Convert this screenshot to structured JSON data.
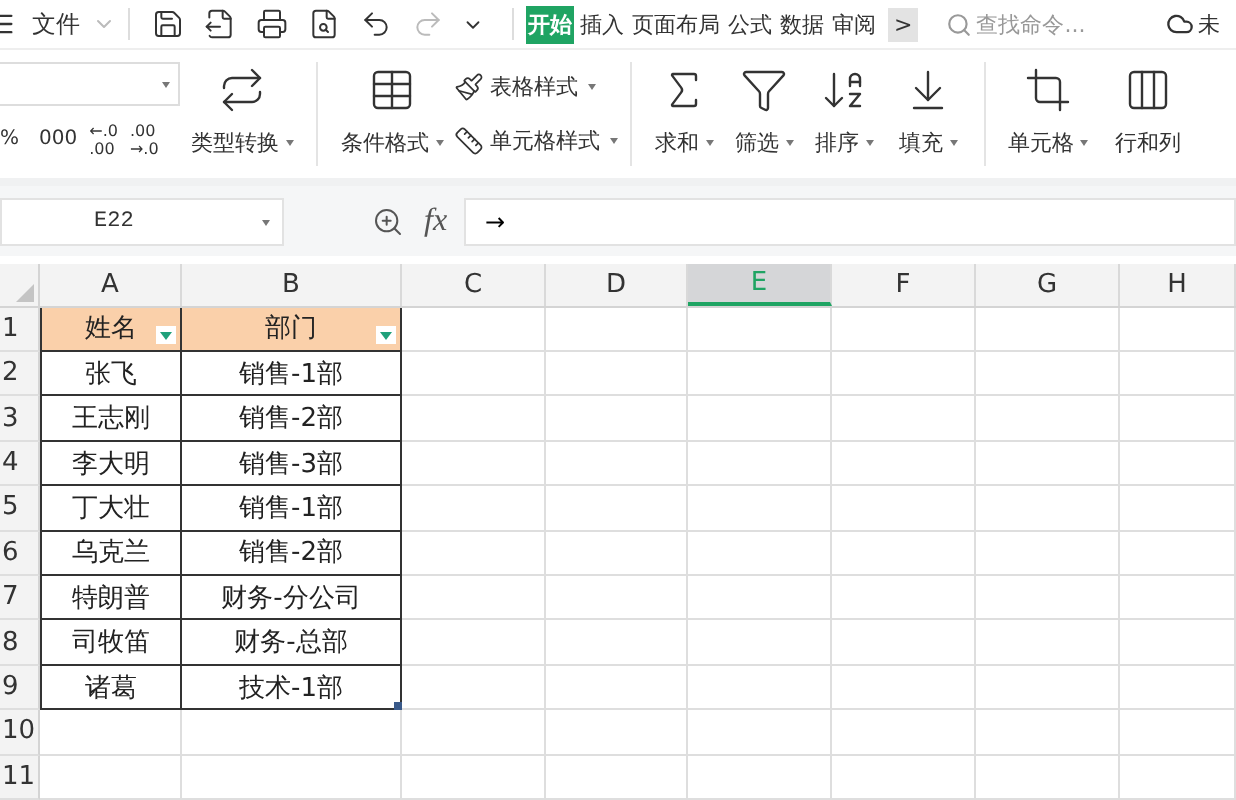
{
  "menu_bar": {
    "file_menu": "文件",
    "tabs": [
      {
        "label": "开始",
        "selected": true
      },
      {
        "label": "插入",
        "selected": false
      },
      {
        "label": "页面布局",
        "selected": false
      },
      {
        "label": "公式",
        "selected": false
      },
      {
        "label": "数据",
        "selected": false
      },
      {
        "label": "审阅",
        "selected": false
      }
    ],
    "more_tabs": ">",
    "search": {
      "placeholder": "查找命令..."
    },
    "cloud_status": "未"
  },
  "ribbon": {
    "percent": "%",
    "thousands": "000",
    "decimal_buttons": [
      {
        "top": "←.0",
        "bottom": ".00"
      },
      {
        "top": ".00",
        "bottom": "→.0"
      }
    ],
    "large_buttons_left": [
      {
        "label": "类型转换",
        "has_menu": true
      },
      {
        "label": "条件格式",
        "has_menu": true
      }
    ],
    "small_buttons": [
      {
        "label": "表格样式",
        "has_menu": true
      },
      {
        "label": "单元格样式",
        "has_menu": true
      }
    ],
    "large_buttons_right": [
      {
        "label": "求和",
        "has_menu": true
      },
      {
        "label": "筛选",
        "has_menu": true
      },
      {
        "label": "排序",
        "has_menu": true
      },
      {
        "label": "填充",
        "has_menu": true
      },
      {
        "label": "单元格",
        "has_menu": true
      },
      {
        "label": "行和列",
        "has_menu": false
      }
    ]
  },
  "formula_bar": {
    "name_box": "E22",
    "function_label": "fx",
    "value": "→"
  },
  "sheet": {
    "columns": [
      {
        "label": "A",
        "selected": false
      },
      {
        "label": "B",
        "selected": false
      },
      {
        "label": "C",
        "selected": false
      },
      {
        "label": "D",
        "selected": false
      },
      {
        "label": "E",
        "selected": true
      },
      {
        "label": "F",
        "selected": false
      },
      {
        "label": "G",
        "selected": false
      },
      {
        "label": "H",
        "selected": false
      }
    ],
    "rows": [
      {
        "number": "1",
        "kind": "header",
        "cells": [
          "姓名",
          "部门"
        ]
      },
      {
        "number": "2",
        "kind": "data",
        "cells": [
          "张飞",
          "销售-1部"
        ]
      },
      {
        "number": "3",
        "kind": "data",
        "cells": [
          "王志刚",
          "销售-2部"
        ]
      },
      {
        "number": "4",
        "kind": "data",
        "cells": [
          "李大明",
          "销售-3部"
        ]
      },
      {
        "number": "5",
        "kind": "data",
        "cells": [
          "丁大壮",
          "销售-1部"
        ]
      },
      {
        "number": "6",
        "kind": "data",
        "cells": [
          "乌克兰",
          "销售-2部"
        ]
      },
      {
        "number": "7",
        "kind": "data",
        "cells": [
          "特朗普",
          "财务-分公司"
        ]
      },
      {
        "number": "8",
        "kind": "data",
        "cells": [
          "司牧笛",
          "财务-总部"
        ]
      },
      {
        "number": "9",
        "kind": "data",
        "cells": [
          "诸葛",
          "技术-1部"
        ]
      },
      {
        "number": "10",
        "kind": "empty"
      },
      {
        "number": "11",
        "kind": "empty"
      }
    ]
  }
}
